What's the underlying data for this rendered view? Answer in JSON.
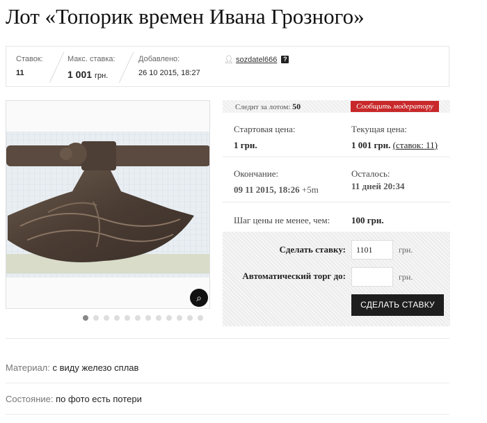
{
  "title": "Лот «Топорик времен Ивана Грозного»",
  "stats": {
    "bids_label": "Ставок:",
    "bids_value": "11",
    "maxbid_label": "Макс. ставка:",
    "maxbid_value": "1 001",
    "maxbid_unit": "грн.",
    "added_label": "Добавлено:",
    "added_value": "26 10 2015, 18:27",
    "seller": "sozdatel666",
    "help_mark": "?"
  },
  "image": {
    "subject": "axe-head photo",
    "dots_count": 12,
    "active_dot": 0
  },
  "panel": {
    "follow_label": "Следит за лотом:",
    "follow_value": "50",
    "report_label": "Сообщить модератору",
    "start_price_label": "Стартовая цена:",
    "start_price_value": "1 грн.",
    "current_price_label": "Текущая цена:",
    "current_price_value": "1 001 грн.",
    "current_price_bids": "(ставок: 11)",
    "end_label": "Окончание:",
    "end_value": "09 11 2015, 18:26",
    "end_tz": "+5m",
    "left_label": "Осталось:",
    "left_value": "11 дней 20:34",
    "step_label": "Шаг цены не менее, чем:",
    "step_value": "100 грн."
  },
  "bid": {
    "bid_label": "Сделать ставку:",
    "bid_value": "1101",
    "bid_unit": "грн.",
    "auto_label": "Автоматический торг до:",
    "auto_value": "",
    "auto_unit": "грн.",
    "submit_label": "СДЕЛАТЬ СТАВКУ"
  },
  "attributes": [
    {
      "key": "Материал:",
      "value": "с виду железо сплав"
    },
    {
      "key": "Состояние:",
      "value": "по фото есть потери"
    }
  ],
  "colors": {
    "report_bg": "#c8282a",
    "button_bg": "#1e1e1e"
  }
}
